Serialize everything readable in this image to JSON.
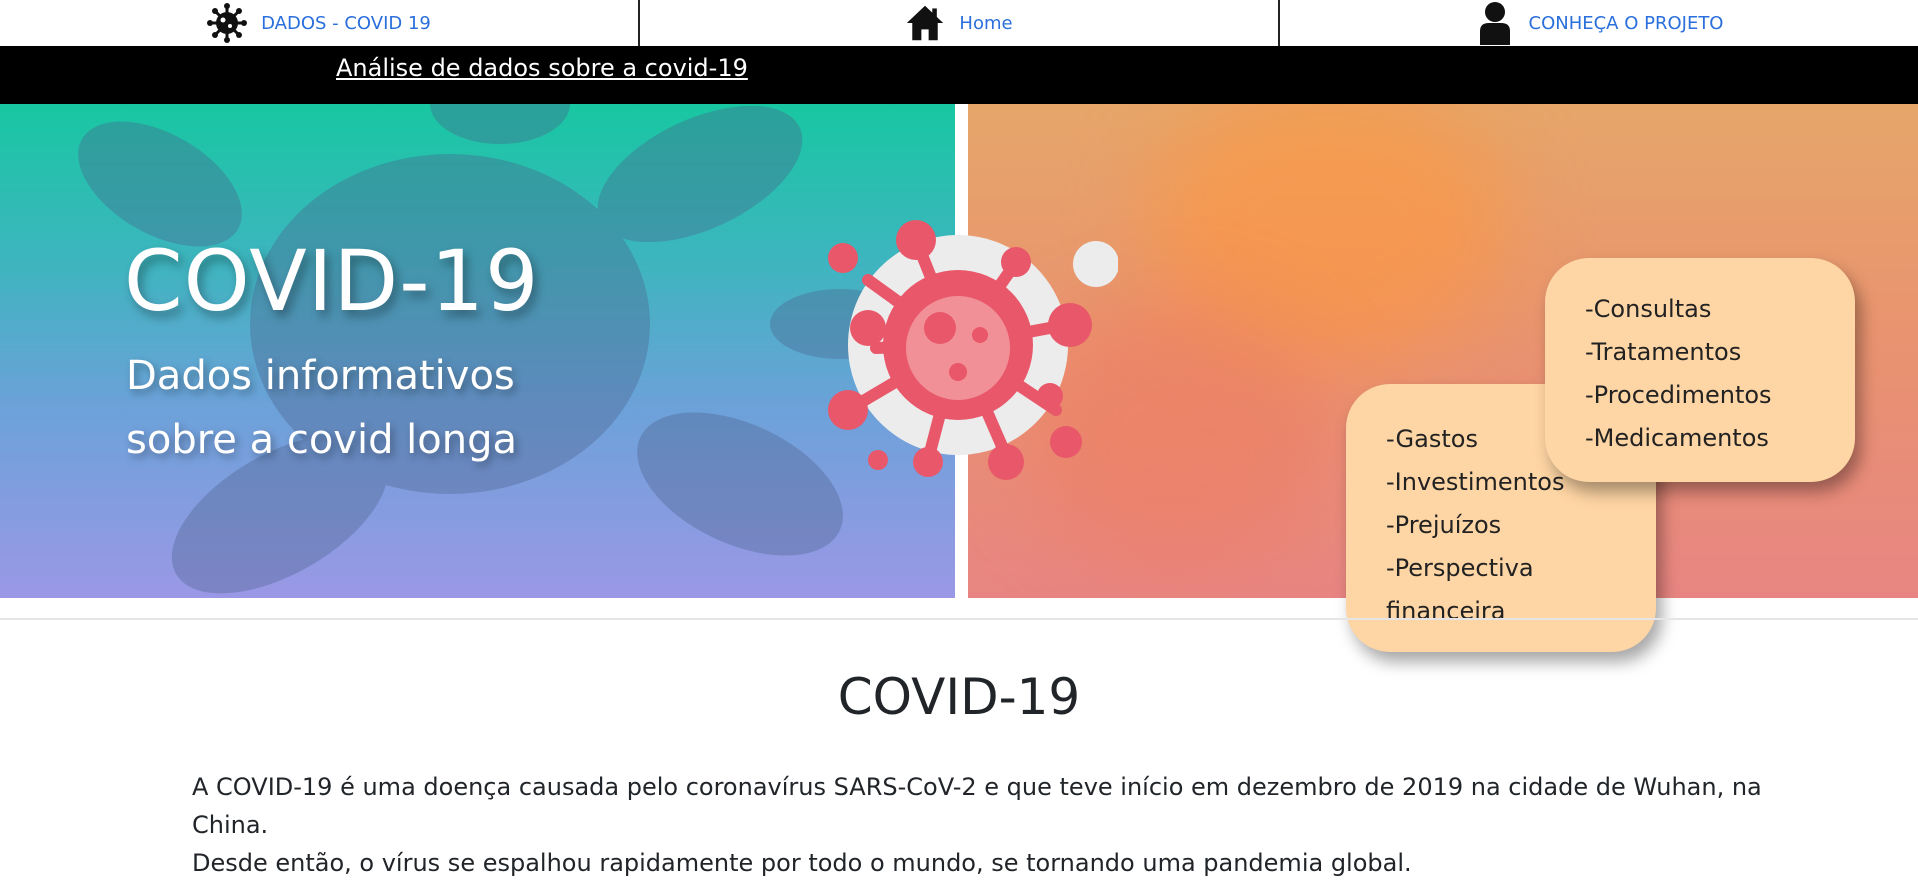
{
  "nav": {
    "items": [
      {
        "label": "DADOS - COVID 19",
        "icon": "virus-icon"
      },
      {
        "label": "Home",
        "icon": "home-icon"
      },
      {
        "label": "CONHEÇA O PROJETO",
        "icon": "user-icon"
      }
    ]
  },
  "subheader": {
    "link_text": "Análise de dados sobre a covid-19"
  },
  "hero": {
    "title": "COVID-19",
    "subtitle": "Dados informativos sobre a covid longa",
    "card_finance": [
      "-Gastos",
      "-Investimentos",
      "-Prejuízos",
      "-Perspectiva financeira"
    ],
    "card_health": [
      "-Consultas",
      "-Tratamentos",
      "-Procedimentos",
      "-Medicamentos"
    ]
  },
  "section": {
    "title": "COVID-19",
    "paragraph_1": "A COVID-19 é uma doença causada pelo coronavírus SARS-CoV-2 e que teve início em dezembro de 2019 na cidade de Wuhan, na China.",
    "paragraph_2": "Desde então, o vírus se espalhou rapidamente por todo o mundo, se tornando uma pandemia global."
  },
  "colors": {
    "nav_link": "#2a6fdb",
    "card_bg": "#fed5a4",
    "virus_red": "#e8576a"
  }
}
